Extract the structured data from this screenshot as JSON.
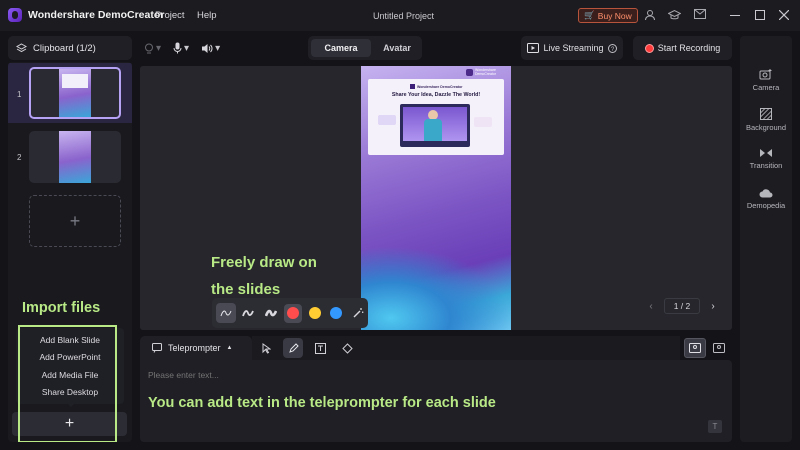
{
  "titlebar": {
    "app_name": "Wondershare DemoCreator",
    "menu": [
      "Project",
      "Help"
    ],
    "document_title": "Untitled Project",
    "buy_now": "Buy Now"
  },
  "clipboard": {
    "title": "Clipboard (1/2)"
  },
  "mode_tabs": {
    "camera": "Camera",
    "avatar": "Avatar",
    "active": "Camera"
  },
  "buttons": {
    "live_streaming": "Live Streaming",
    "start_recording": "Start Recording"
  },
  "slides": [
    {
      "number": "1",
      "selected": true
    },
    {
      "number": "2",
      "selected": false
    }
  ],
  "add_menu": {
    "items": [
      "Add Blank Slide",
      "Add PowerPoint",
      "Add Media File",
      "Share Desktop"
    ],
    "add_symbol": "+"
  },
  "slide_preview": {
    "brand": "Wondershare DemoCreator",
    "card_brand": "Wondershare DemoCreator",
    "headline": "Share Your Idea, Dazzle The World!"
  },
  "pager": {
    "label": "1 / 2"
  },
  "teleprompter": {
    "tab_label": "Teleprompter",
    "placeholder": "Please enter text..."
  },
  "right_panel": [
    {
      "label": "Camera",
      "icon": "camera-plus-icon"
    },
    {
      "label": "Background",
      "icon": "background-icon"
    },
    {
      "label": "Transition",
      "icon": "transition-icon"
    },
    {
      "label": "Demopedia",
      "icon": "cloud-icon"
    }
  ],
  "colors": {
    "accent": "#8b5cf6",
    "annotation": "#b8e986",
    "record": "#ff3b3b",
    "swatch_red": "#ff4d4d",
    "swatch_yellow": "#ffcc33",
    "swatch_blue": "#3399ff"
  },
  "annotations": {
    "import_files": "Import files",
    "draw_line1": "Freely draw on",
    "draw_line2": "the slides",
    "teleprompter_note": "You can add text in the teleprompter for each slide"
  }
}
